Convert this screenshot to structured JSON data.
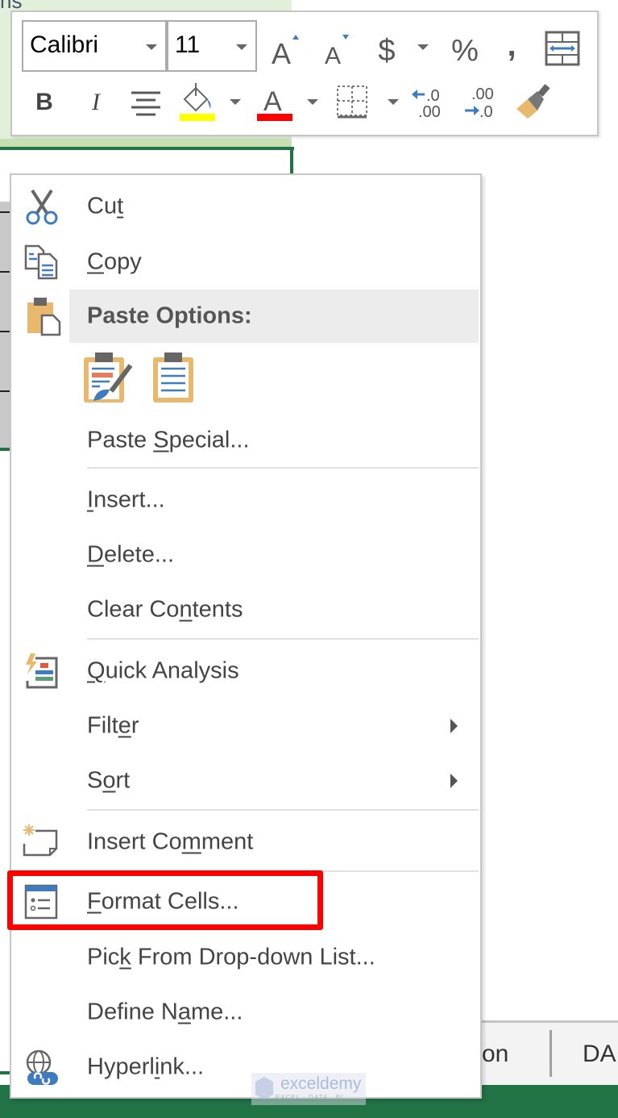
{
  "background": {
    "sheet_title_fragment": "ns",
    "sheet_tabs": [
      {
        "label": "on"
      },
      {
        "label": "DA"
      }
    ],
    "watermark": {
      "name": "exceldemy",
      "tagline": "EXCEL · DATA · BI"
    }
  },
  "mini_toolbar": {
    "font_name": "Calibri",
    "font_size": "11",
    "row1": [
      {
        "name": "increase-font-size",
        "glyph": "A"
      },
      {
        "name": "decrease-font-size",
        "glyph": "A"
      },
      {
        "name": "accounting-format",
        "glyph": "$"
      },
      {
        "name": "percent-style",
        "glyph": "%"
      },
      {
        "name": "comma-style",
        "glyph": ","
      },
      {
        "name": "merge-and-center",
        "glyph": ""
      }
    ],
    "row2": [
      {
        "name": "bold",
        "glyph": "B"
      },
      {
        "name": "italic",
        "glyph": "I"
      },
      {
        "name": "center",
        "glyph": ""
      },
      {
        "name": "fill-color",
        "glyph": ""
      },
      {
        "name": "font-color",
        "glyph": "A"
      },
      {
        "name": "borders",
        "glyph": ""
      },
      {
        "name": "increase-decimal",
        "glyph": ".0 .00"
      },
      {
        "name": "decrease-decimal",
        "glyph": ".00 .0"
      },
      {
        "name": "format-painter",
        "glyph": ""
      }
    ],
    "colors": {
      "fill": "#ffff00",
      "font": "#ff0000",
      "accent": "#3f7cbf"
    }
  },
  "context_menu": {
    "items": {
      "cut": {
        "pre": "Cu",
        "u": "t",
        "post": ""
      },
      "copy": {
        "pre": "",
        "u": "C",
        "post": "opy"
      },
      "paste_options": {
        "label": "Paste Options:"
      },
      "paste_special": {
        "pre": "Paste ",
        "u": "S",
        "post": "pecial..."
      },
      "insert": {
        "pre": "",
        "u": "I",
        "post": "nsert..."
      },
      "delete": {
        "pre": "",
        "u": "D",
        "post": "elete..."
      },
      "clear_contents": {
        "pre": "Clear Co",
        "u": "n",
        "post": "tents"
      },
      "quick_analysis": {
        "pre": "",
        "u": "Q",
        "post": "uick Analysis"
      },
      "filter": {
        "pre": "Filt",
        "u": "e",
        "post": "r"
      },
      "sort": {
        "pre": "S",
        "u": "o",
        "post": "rt"
      },
      "insert_comment": {
        "pre": "Insert Co",
        "u": "m",
        "post": "ment"
      },
      "format_cells": {
        "pre": "",
        "u": "F",
        "post": "ormat Cells..."
      },
      "pick_from_list": {
        "pre": "Pic",
        "u": "k",
        "post": " From Drop-down List..."
      },
      "define_name": {
        "pre": "Define N",
        "u": "a",
        "post": "me..."
      },
      "hyperlink": {
        "pre": "Hyperl",
        "u": "i",
        "post": "nk..."
      }
    },
    "highlighted_item": "Format Cells...",
    "highlight_color": "#ff0000"
  }
}
